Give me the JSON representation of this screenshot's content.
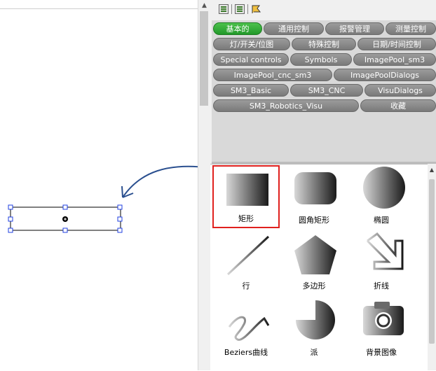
{
  "toolbox": {
    "tabs_row1": [
      "基本的",
      "通用控制",
      "报警管理",
      "测量控制"
    ],
    "tabs_row2": [
      "灯/开关/位图",
      "特殊控制",
      "日期/时间控制"
    ],
    "tabs_row3": [
      "Special controls",
      "Symbols",
      "ImagePool_sm3"
    ],
    "tabs_row4": [
      "ImagePool_cnc_sm3",
      "ImagePoolDialogs"
    ],
    "tabs_row5": [
      "SM3_Basic",
      "SM3_CNC",
      "VisuDialogs"
    ],
    "tabs_row6": [
      "SM3_Robotics_Visu",
      "收藏"
    ],
    "active_tab": "基本的",
    "items": [
      {
        "label": "矩形",
        "icon": "rectangle-icon",
        "selected": true
      },
      {
        "label": "圆角矩形",
        "icon": "rounded-rectangle-icon",
        "selected": false
      },
      {
        "label": "椭圆",
        "icon": "ellipse-icon",
        "selected": false
      },
      {
        "label": "行",
        "icon": "line-icon",
        "selected": false
      },
      {
        "label": "多边形",
        "icon": "polygon-icon",
        "selected": false
      },
      {
        "label": "折线",
        "icon": "polyline-icon",
        "selected": false
      },
      {
        "label": "Beziers曲线",
        "icon": "bezier-icon",
        "selected": false
      },
      {
        "label": "派",
        "icon": "pie-icon",
        "selected": false
      },
      {
        "label": "背景图像",
        "icon": "camera-icon",
        "selected": false
      }
    ]
  },
  "colors": {
    "tab_active": "#22992a",
    "tab_inactive": "#8a8a8a",
    "selection": "#e0201e",
    "arrow": "#2a4f8f",
    "handle": "#1f3fe0"
  }
}
